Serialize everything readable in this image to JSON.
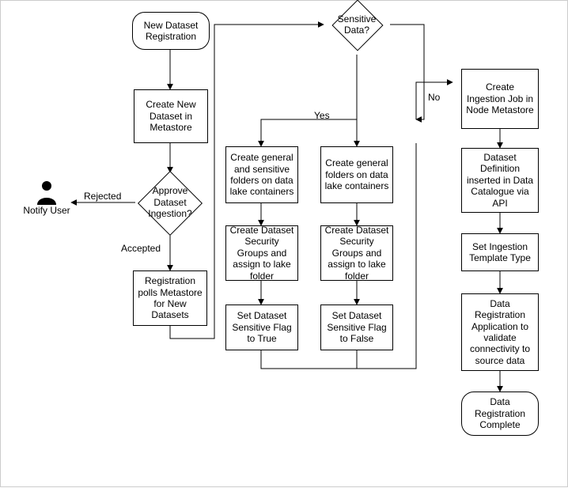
{
  "diagram": {
    "start": "New Dataset Registration",
    "createDataset": "Create New Dataset in Metastore",
    "approve": "Approve Dataset Ingestion?",
    "rejected": "Rejected",
    "accepted": "Accepted",
    "notifyUser": "Notify User",
    "poll": "Registration polls Metastore for New Datasets",
    "sensitive": "Sensitive Data?",
    "yes": "Yes",
    "no": "No",
    "yesFolders": "Create general and sensitive folders on data lake containers",
    "noFolders": "Create general folders on data lake containers",
    "yesGroups": "Create Dataset Security Groups and assign to lake folder",
    "noGroups": "Create Dataset Security Groups and assign to lake folder",
    "yesFlag": "Set Dataset Sensitive Flag to True",
    "noFlag": "Set Dataset Sensitive Flag to False",
    "createJob": "Create Ingestion Job in Node Metastore",
    "catalogue": "Dataset Definition inserted in Data Catalogue via API",
    "setTemplate": "Set Ingestion Template Type",
    "validate": "Data Registration Application to validate connectivity to source data",
    "complete": "Data Registration Complete"
  }
}
